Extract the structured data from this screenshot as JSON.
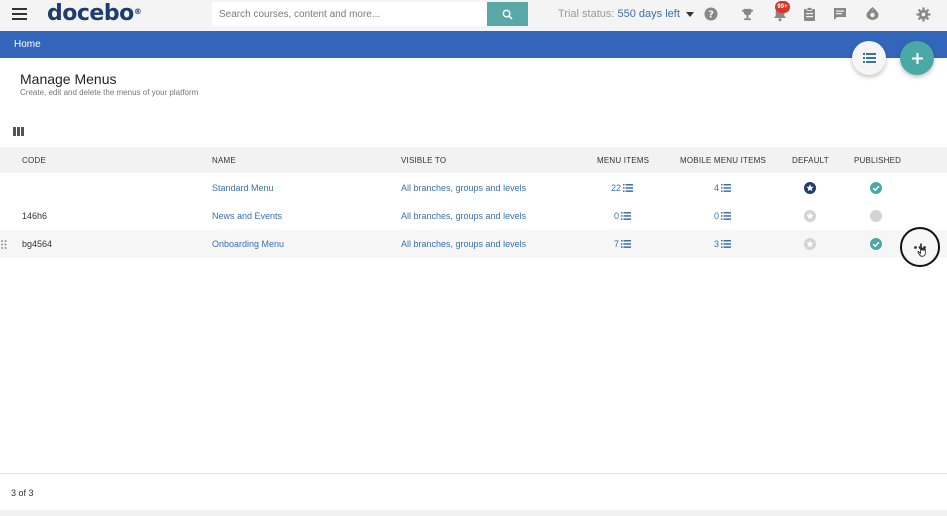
{
  "header": {
    "logo_text": "docebo",
    "logo_mark": "®",
    "search_placeholder": "Search courses, content and more...",
    "trial_label": "Trial status:",
    "trial_days": "550 days left",
    "notification_count": "99+",
    "icons": [
      "menu-icon",
      "search-icon",
      "help-icon",
      "trophy-icon",
      "bell-icon",
      "clipboard-icon",
      "chat-icon",
      "player-icon",
      "gear-icon"
    ]
  },
  "breadcrumb": {
    "home": "Home"
  },
  "page": {
    "title": "Manage Menus",
    "subtitle": "Create, edit and delete the menus of your platform"
  },
  "table": {
    "columns": [
      "CODE",
      "NAME",
      "VISIBLE TO",
      "MENU ITEMS",
      "MOBILE MENU ITEMS",
      "DEFAULT",
      "PUBLISHED"
    ],
    "rows": [
      {
        "code": "",
        "name": "Standard Menu",
        "visible_to": "All branches, groups and levels",
        "menu_items": "22",
        "mobile_menu_items": "4",
        "default": true,
        "published": true
      },
      {
        "code": "146h6",
        "name": "News and Events",
        "visible_to": "All branches, groups and levels",
        "menu_items": "0",
        "mobile_menu_items": "0",
        "default": false,
        "published": false
      },
      {
        "code": "bg4564",
        "name": "Onboarding Menu",
        "visible_to": "All branches, groups and levels",
        "menu_items": "7",
        "mobile_menu_items": "3",
        "default": false,
        "published": true
      }
    ]
  },
  "pagination": {
    "text": "3 of 3"
  },
  "colors": {
    "brand_blue": "#3366bb",
    "teal": "#4aa9a7",
    "link": "#3a6fb0",
    "badge_red": "#d9342b"
  }
}
